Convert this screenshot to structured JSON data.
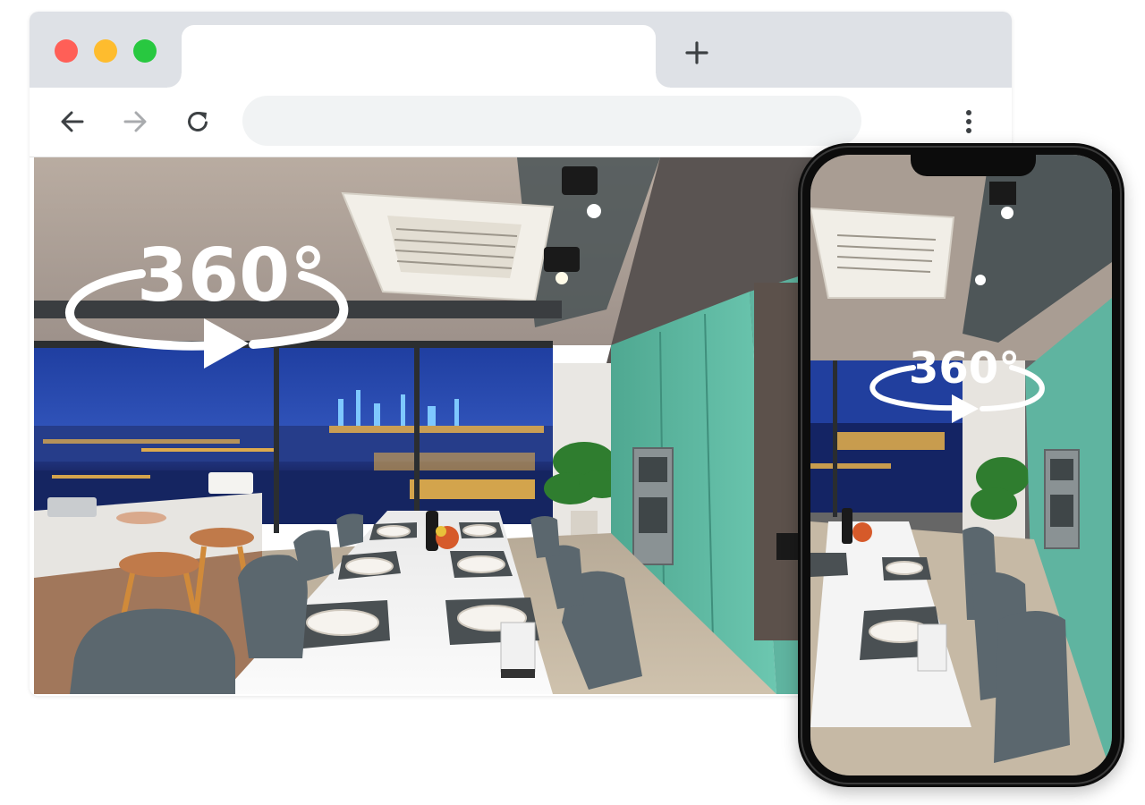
{
  "browser": {
    "window_controls": {
      "close_color": "#ff5f57",
      "minimize_color": "#febc2e",
      "maximize_color": "#28c840"
    },
    "tab": {
      "title": ""
    },
    "new_tab_icon": "plus-icon",
    "toolbar": {
      "back_icon": "arrow-left-icon",
      "forward_icon": "arrow-right-icon",
      "reload_icon": "reload-icon",
      "address_value": "",
      "menu_icon": "vertical-dots-icon"
    }
  },
  "scene": {
    "description_icon": "360-view-icon",
    "badge_text": "360°",
    "accent_colors": {
      "cabinet_teal": "#5fb8a2",
      "city_night_sky": "#1e3f9c",
      "table_white": "#f4f4f4",
      "chair_gray": "#59666d"
    }
  },
  "phone": {
    "badge_text": "360°"
  }
}
